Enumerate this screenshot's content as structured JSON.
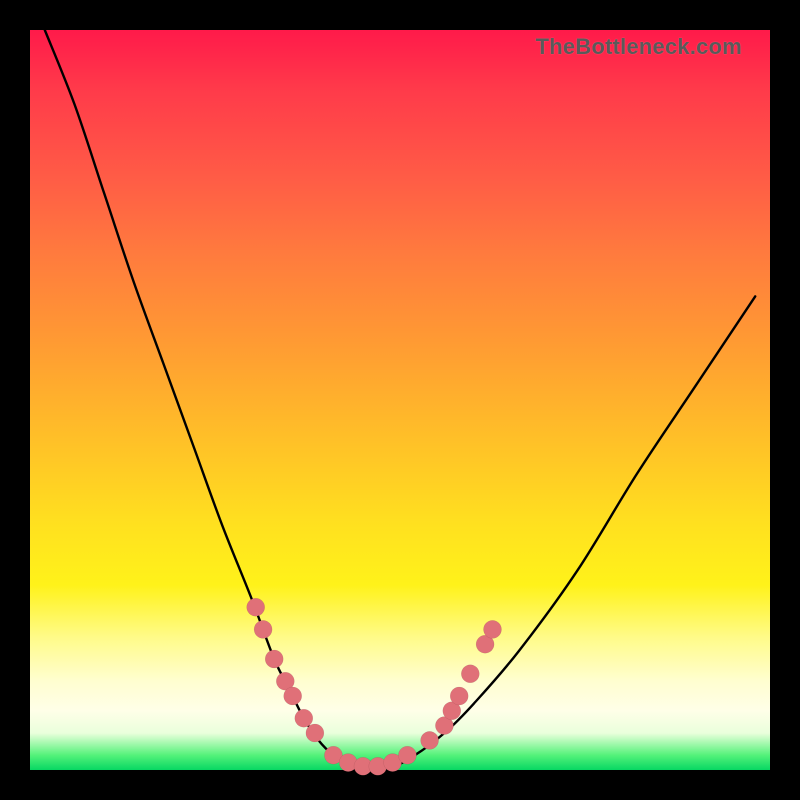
{
  "attribution": "TheBottleneck.com",
  "colors": {
    "frame": "#000000",
    "curve": "#000000",
    "marker": "#e07078",
    "gradient_top": "#ff1a4a",
    "gradient_bottom": "#07d763"
  },
  "chart_data": {
    "type": "line",
    "title": "",
    "xlabel": "",
    "ylabel": "",
    "xlim": [
      0,
      100
    ],
    "ylim": [
      0,
      100
    ],
    "grid": false,
    "legend": false,
    "annotations": [],
    "series": [
      {
        "name": "bottleneck-curve",
        "x": [
          2,
          6,
          10,
          14,
          18,
          22,
          26,
          30,
          33,
          35,
          37,
          39,
          41,
          44,
          48,
          52,
          56,
          60,
          66,
          74,
          82,
          90,
          98
        ],
        "y": [
          100,
          90,
          78,
          66,
          55,
          44,
          33,
          23,
          15,
          11,
          7,
          4,
          2,
          0,
          0,
          2,
          5,
          9,
          16,
          27,
          40,
          52,
          64
        ]
      }
    ],
    "markers": [
      {
        "name": "left-cluster",
        "x": 30.5,
        "y": 22
      },
      {
        "name": "left-cluster",
        "x": 31.5,
        "y": 19
      },
      {
        "name": "left-cluster",
        "x": 33.0,
        "y": 15
      },
      {
        "name": "left-cluster",
        "x": 34.5,
        "y": 12
      },
      {
        "name": "left-cluster",
        "x": 35.5,
        "y": 10
      },
      {
        "name": "left-cluster",
        "x": 37.0,
        "y": 7
      },
      {
        "name": "left-cluster",
        "x": 38.5,
        "y": 5
      },
      {
        "name": "bottom-run",
        "x": 41.0,
        "y": 2
      },
      {
        "name": "bottom-run",
        "x": 43.0,
        "y": 1
      },
      {
        "name": "bottom-run",
        "x": 45.0,
        "y": 0.5
      },
      {
        "name": "bottom-run",
        "x": 47.0,
        "y": 0.5
      },
      {
        "name": "bottom-run",
        "x": 49.0,
        "y": 1
      },
      {
        "name": "bottom-run",
        "x": 51.0,
        "y": 2
      },
      {
        "name": "right-cluster",
        "x": 54.0,
        "y": 4
      },
      {
        "name": "right-cluster",
        "x": 56.0,
        "y": 6
      },
      {
        "name": "right-cluster",
        "x": 57.0,
        "y": 8
      },
      {
        "name": "right-cluster",
        "x": 58.0,
        "y": 10
      },
      {
        "name": "right-cluster",
        "x": 59.5,
        "y": 13
      },
      {
        "name": "right-cluster",
        "x": 61.5,
        "y": 17
      },
      {
        "name": "right-cluster",
        "x": 62.5,
        "y": 19
      }
    ],
    "marker_radius": 9
  }
}
